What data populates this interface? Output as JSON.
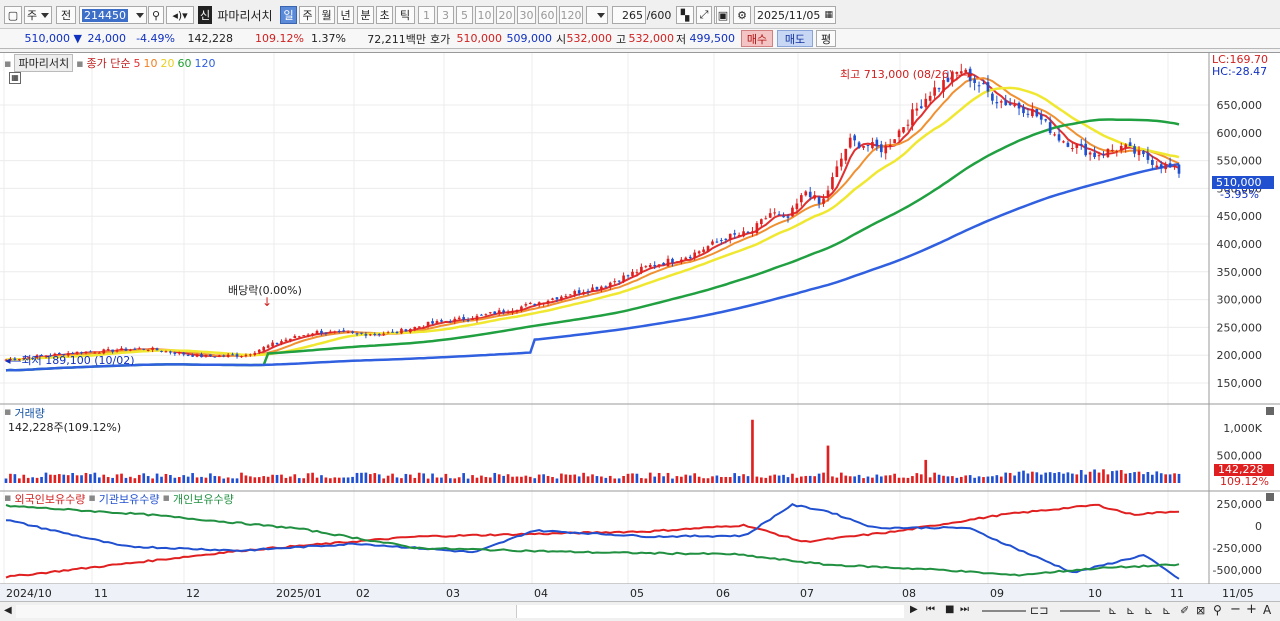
{
  "toolbar": {
    "market": "주",
    "period_type": "전",
    "code": "214450",
    "badge_new": "신",
    "stock_name": "파마리서치",
    "periods": [
      "일",
      "주",
      "월",
      "년",
      "분",
      "초",
      "틱"
    ],
    "intervals": [
      "1",
      "3",
      "5",
      "10",
      "20",
      "30",
      "60",
      "120"
    ],
    "count": "265",
    "max_count": "/600",
    "date": "2025/11/05"
  },
  "quote": {
    "price": "510,000",
    "change": "24,000",
    "change_pct": "-4.49%",
    "volume": "142,228",
    "volume_ratio": "109.12%",
    "turnover": "1.37%",
    "amount": "72,211백만",
    "ask_label": "호가",
    "ask1": "510,000",
    "ask2": "509,000",
    "open_label": "시",
    "open": "532,000",
    "high_label": "고",
    "high": "532,000",
    "low_label": "저",
    "low": "499,500",
    "buy": "매수",
    "sell": "매도",
    "eval": "평"
  },
  "price_panel": {
    "title": "파마리서치",
    "ma_title": "종가 단순",
    "ma_periods": [
      {
        "label": "5",
        "color": "#e03030"
      },
      {
        "label": "10",
        "color": "#f08020"
      },
      {
        "label": "20",
        "color": "#f0e020"
      },
      {
        "label": "60",
        "color": "#20a030"
      },
      {
        "label": "120",
        "color": "#3060e0"
      }
    ],
    "lc": "LC:169.70",
    "hc": "HC:-28.47",
    "current_price": "510,000",
    "current_pct": "-3.95%",
    "high_note": "최고 713,000 (08/26)",
    "low_note": "최저 189,100 (10/02)",
    "div_note": "배당락(0.00%)",
    "y_ticks": [
      "650,000",
      "600,000",
      "550,000",
      "500,000",
      "450,000",
      "400,000",
      "350,000",
      "300,000",
      "250,000",
      "200,000",
      "150,000"
    ]
  },
  "volume_panel": {
    "title": "거래량",
    "value": "142,228주(109.12%)",
    "y_ticks": [
      "1,000K",
      "500,000"
    ],
    "current": "142,228",
    "current_pct": "109.12%"
  },
  "holding_panel": {
    "legend": [
      {
        "label": "외국인보유수량",
        "color": "#e03030"
      },
      {
        "label": "기관보유수량",
        "color": "#3060e0"
      },
      {
        "label": "개인보유수량",
        "color": "#209040"
      }
    ],
    "y_ticks": [
      "250,000",
      "0",
      "-250,000",
      "-500,000"
    ]
  },
  "x_axis": [
    "2024/10",
    "11",
    "12",
    "2025/01",
    "02",
    "03",
    "04",
    "05",
    "06",
    "07",
    "08",
    "09",
    "10",
    "11",
    "11/05"
  ],
  "colors": {
    "up": "#e02020",
    "down": "#2050d0",
    "accent": "#0a3a9a"
  }
}
